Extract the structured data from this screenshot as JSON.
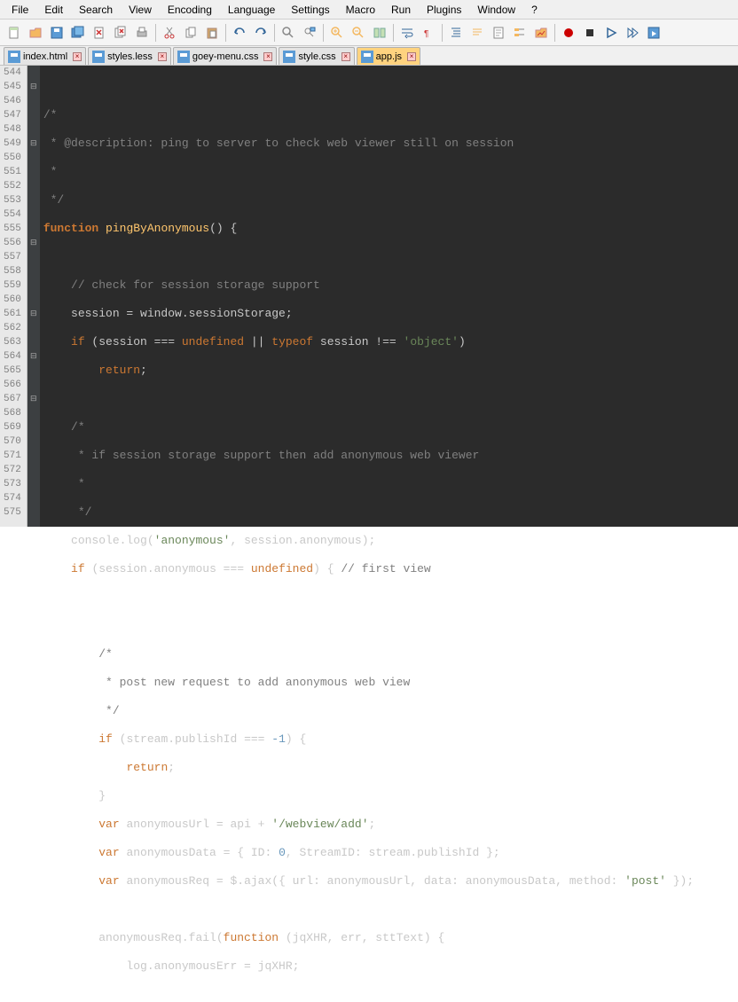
{
  "menu": [
    "File",
    "Edit",
    "Search",
    "View",
    "Encoding",
    "Language",
    "Settings",
    "Macro",
    "Run",
    "Plugins",
    "Window",
    "?"
  ],
  "tabs": [
    {
      "label": "index.html",
      "active": false
    },
    {
      "label": "styles.less",
      "active": false
    },
    {
      "label": "goey-menu.css",
      "active": false
    },
    {
      "label": "style.css",
      "active": false
    },
    {
      "label": "app.js",
      "active": true
    }
  ],
  "lines": {
    "start": 544,
    "end": 575
  },
  "code": {
    "l544": "",
    "l545": "/*",
    "l546": " * @description: ping to server to check web viewer still on session",
    "l547": " *",
    "l548": " */",
    "l549_fnkw": "function",
    "l549_fn": " pingByAnonymous",
    "l549_rest": "() {",
    "l550": "",
    "l551": "    // check for session storage support",
    "l552": "    session = window.sessionStorage;",
    "l553_if": "    if",
    "l553_a": " (session === ",
    "l553_b": "undefined",
    "l553_c": " || ",
    "l553_d": "typeof",
    "l553_e": " session !== ",
    "l553_f": "'object'",
    "l553_g": ")",
    "l554_a": "        ",
    "l554_b": "return",
    "l554_c": ";",
    "l555": "",
    "l556": "    /*",
    "l557": "     * if session storage support then add anonymous web viewer",
    "l558": "     *",
    "l559": "     */",
    "l560_a": "    console.log(",
    "l560_b": "'anonymous'",
    "l560_c": ", session.anonymous);",
    "l561_a": "    ",
    "l561_b": "if",
    "l561_c": " (session.anonymous === ",
    "l561_d": "undefined",
    "l561_e": ") { ",
    "l561_f": "// first view",
    "l562": "",
    "l563": "",
    "l564": "        /*",
    "l565": "         * post new request to add anonymous web view",
    "l566": "         */",
    "l567_a": "        ",
    "l567_b": "if",
    "l567_c": " (stream.publishId === ",
    "l567_d": "-1",
    "l567_e": ") {",
    "l568_a": "            ",
    "l568_b": "return",
    "l568_c": ";",
    "l569": "        }",
    "l570_a": "        ",
    "l570_b": "var",
    "l570_c": " anonymousUrl = api + ",
    "l570_d": "'/webview/add'",
    "l570_e": ";",
    "l571_a": "        ",
    "l571_b": "var",
    "l571_c": " anonymousData = { ID: ",
    "l571_d": "0",
    "l571_e": ", StreamID: stream.publishId };",
    "l572_a": "        ",
    "l572_b": "var",
    "l572_c": " anonymousReq = $.ajax({ url: anonymousUrl, data: anonymousData, method: ",
    "l572_d": "'post'",
    "l572_e": " });",
    "l573": "",
    "l574_a": "        anonymousReq.fail(",
    "l574_b": "function",
    "l574_c": " (jqXHR, err, sttText) {",
    "l575": "            log.anonymousErr = jqXHR;"
  },
  "icons": {
    "new": "new",
    "open": "open",
    "save": "save",
    "saveall": "saveall",
    "close": "close",
    "closeall": "closeall",
    "print": "print",
    "cut": "cut",
    "copy": "copy",
    "paste": "paste",
    "undo": "undo",
    "redo": "redo",
    "find": "find",
    "replace": "replace",
    "zoomin": "zoomin",
    "zoomout": "zoomout",
    "sync": "sync",
    "wrap": "wrap",
    "all": "all",
    "indent": "indent",
    "guide": "guide",
    "lang": "lang",
    "doc": "doc",
    "fold": "fold",
    "rec": "rec",
    "stop": "stop",
    "play": "play",
    "play2": "play2",
    "playlist": "playlist"
  }
}
